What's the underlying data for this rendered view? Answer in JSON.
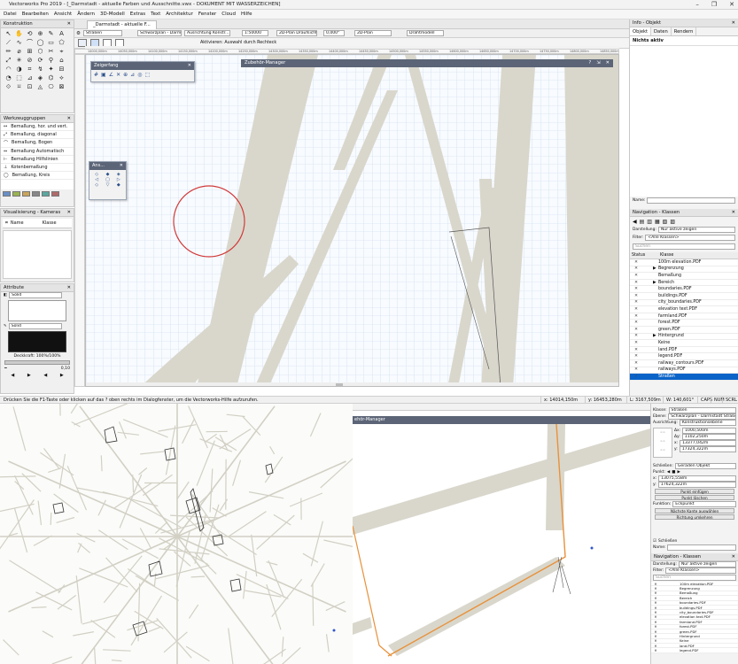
{
  "app": {
    "title": "Vectorworks Pro 2019 - [_Darmstadt - aktuelle Farben und Ausschnitte.vwx - DOKUMENT MIT WASSERZEICHEN]",
    "window_controls": [
      "–",
      "❐",
      "✕"
    ]
  },
  "menu": [
    "Datei",
    "Bearbeiten",
    "Ansicht",
    "Ändern",
    "3D-Modell",
    "Extras",
    "Text",
    "Architektur",
    "Fenster",
    "Cloud",
    "Hilfe"
  ],
  "document_tab": "_Darmstadt - aktuelle F...",
  "view_bar": {
    "class_combo": "Straßen",
    "layer_combo": "Schwarzplan - Darms...",
    "align_combo": "Ausrichtung Konstr...",
    "scale": "1:50000",
    "projection": "2D-Plan Draufsicht",
    "angle": "0,000°",
    "view": "2D-Plan",
    "render": "Drahtmodell"
  },
  "mode_bar": {
    "hint": "Aktivieren: Auswahl durch Rechteck"
  },
  "ruler_ticks": [
    "14000,000m",
    "14050,000m",
    "14100,000m",
    "14150,000m",
    "14200,000m",
    "14250,000m",
    "14300,000m",
    "14350,000m",
    "14400,000m",
    "14450,000m",
    "14500,000m",
    "14550,000m",
    "14600,000m",
    "14650,000m",
    "14700,000m",
    "14750,000m",
    "14800,000m",
    "14850,000m"
  ],
  "left_panels": {
    "konstruktion": "Konstruktion",
    "werkzeuggruppen": "Werkzeuggruppen",
    "werkzeuge": [
      "Bemaßung, hor. und vert.",
      "Bemaßung, diagonal",
      "Bemaßung, Bogen",
      "Bemaßung Automatisch",
      "Bemaßung Hilfslinien",
      "Kotenbemaßung",
      "Bemaßung, Kreis"
    ],
    "visualisierung": "Visualisierung - Kameras",
    "vis_columns": [
      "Name",
      "Klasse"
    ],
    "attribute": "Attribute",
    "fill": "Solid",
    "pen": "Solid",
    "opacity": "Deckkraft: 100%/100%",
    "line_value": "0,10"
  },
  "floating": {
    "zeigerfang": "Zeigerfang",
    "ansicht": "Ans...",
    "zubehoer": "Zubehör-Manager",
    "zubehoer_short": "ehör-Manager"
  },
  "status_bar": {
    "hint": "Drücken Sie die F1-Taste oder klicken auf das ? oben rechts im Dialogfenster, um die Vectorworks-Hilfe aufzurufen.",
    "x": "x: 14014,150m",
    "y": "y: 16453,280m",
    "l": "L: 3167,509m",
    "w": "W: 140,601°",
    "caps": "CAPS",
    "num": "NUM",
    "scrl": "SCRL"
  },
  "info_panel": {
    "header": "Info - Objekt",
    "tabs": [
      "Objekt",
      "Daten",
      "Rendern"
    ],
    "status": "Nichts aktiv",
    "name_label": "Name:"
  },
  "navigation": {
    "header": "Navigation - Klassen",
    "darstellung_label": "Darstellung:",
    "darstellung_value": "Nur aktive zeigen",
    "filter_label": "Filter:",
    "filter_value": "<Alle Klassen>",
    "search": "Suchen",
    "columns": [
      "Status",
      "Klasse"
    ],
    "rows": [
      {
        "status": "✕",
        "name": "100m elevation.PDF",
        "indent": 1,
        "arrow": false
      },
      {
        "status": "✕",
        "name": "Begrenzung",
        "indent": 1,
        "arrow": true
      },
      {
        "status": "✕",
        "name": "Bemaßung",
        "indent": 1,
        "arrow": false
      },
      {
        "status": "✕",
        "name": "Bereich",
        "indent": 1,
        "arrow": true
      },
      {
        "status": "✕",
        "name": "boundaries.PDF",
        "indent": 1,
        "arrow": false
      },
      {
        "status": "✕",
        "name": "buildings.PDF",
        "indent": 1,
        "arrow": false
      },
      {
        "status": "✕",
        "name": "city_boundaries.PDF",
        "indent": 1,
        "arrow": false
      },
      {
        "status": "✕",
        "name": "elevation text.PDF",
        "indent": 1,
        "arrow": false
      },
      {
        "status": "✕",
        "name": "farmland.PDF",
        "indent": 1,
        "arrow": false
      },
      {
        "status": "✕",
        "name": "forest.PDF",
        "indent": 1,
        "arrow": false
      },
      {
        "status": "✕",
        "name": "green.PDF",
        "indent": 1,
        "arrow": false
      },
      {
        "status": "✕",
        "name": "Hintergrund",
        "indent": 1,
        "arrow": true
      },
      {
        "status": "✕",
        "name": "Keine",
        "indent": 1,
        "arrow": false
      },
      {
        "status": "✕",
        "name": "land.PDF",
        "indent": 1,
        "arrow": false
      },
      {
        "status": "✕",
        "name": "legend.PDF",
        "indent": 1,
        "arrow": false
      },
      {
        "status": "✕",
        "name": "railway_contours.PDF",
        "indent": 1,
        "arrow": false
      },
      {
        "status": "✕",
        "name": "railways.PDF",
        "indent": 1,
        "arrow": false
      },
      {
        "status": "✓",
        "name": "Straßen",
        "indent": 1,
        "arrow": false,
        "selected": true
      }
    ]
  },
  "bottom_right": {
    "klasse_label": "Klasse:",
    "klasse_value": "Straßen",
    "ebene_label": "Ebene:",
    "ebene_value": "Schwarzplan - Darmstadt Straßenmitte",
    "ausrichtung_label": "Ausrichtung:",
    "ausrichtung_value": "Konstruktionsebene",
    "fields": [
      {
        "k": "Δx:",
        "v": "1000,500m"
      },
      {
        "k": "Δy:",
        "v": "1102,250m"
      },
      {
        "k": "x:",
        "v": "13377,042m"
      },
      {
        "k": "y:",
        "v": "17324,322m"
      }
    ],
    "schliessen_label": "Schließen:",
    "schliessen_value": "Geraden Objekt",
    "punkt_label": "Punkt:",
    "punkt_x": "13075,558m",
    "punkt_y": "17624,322m",
    "buttons": [
      "Punkt einfügen",
      "Punkt löschen"
    ],
    "funktion_label": "Funktion:",
    "funktion_value": "Eckpunkt",
    "buttons2": [
      "Nächste Kante auswählen",
      "Richtung umkehren"
    ],
    "schliessen_check": "Schließen",
    "name_label": "Name:",
    "nav_header": "Navigation - Klassen",
    "nav_darstellung": "Nur aktive zeigen",
    "nav_filter": "<Alle Klassen>",
    "nav_search": "Suchen",
    "nav_rows": [
      "100m elevation.PDF",
      "Begrenzung",
      "Bemaßung",
      "Bereich",
      "boundaries.PDF",
      "buildings.PDF",
      "city_boundaries.PDF",
      "elevation text.PDF",
      "farmland.PDF",
      "forest.PDF",
      "green.PDF",
      "Hintergrund",
      "Keine",
      "land.PDF",
      "legend.PDF"
    ]
  },
  "colors": {
    "road": "#d9d7cc",
    "road_edge": "#c9c6b8",
    "grid": "#c5d6ea",
    "circle": "#d23a3a",
    "orange": "#e8913a",
    "accent": "#0a64c8"
  }
}
